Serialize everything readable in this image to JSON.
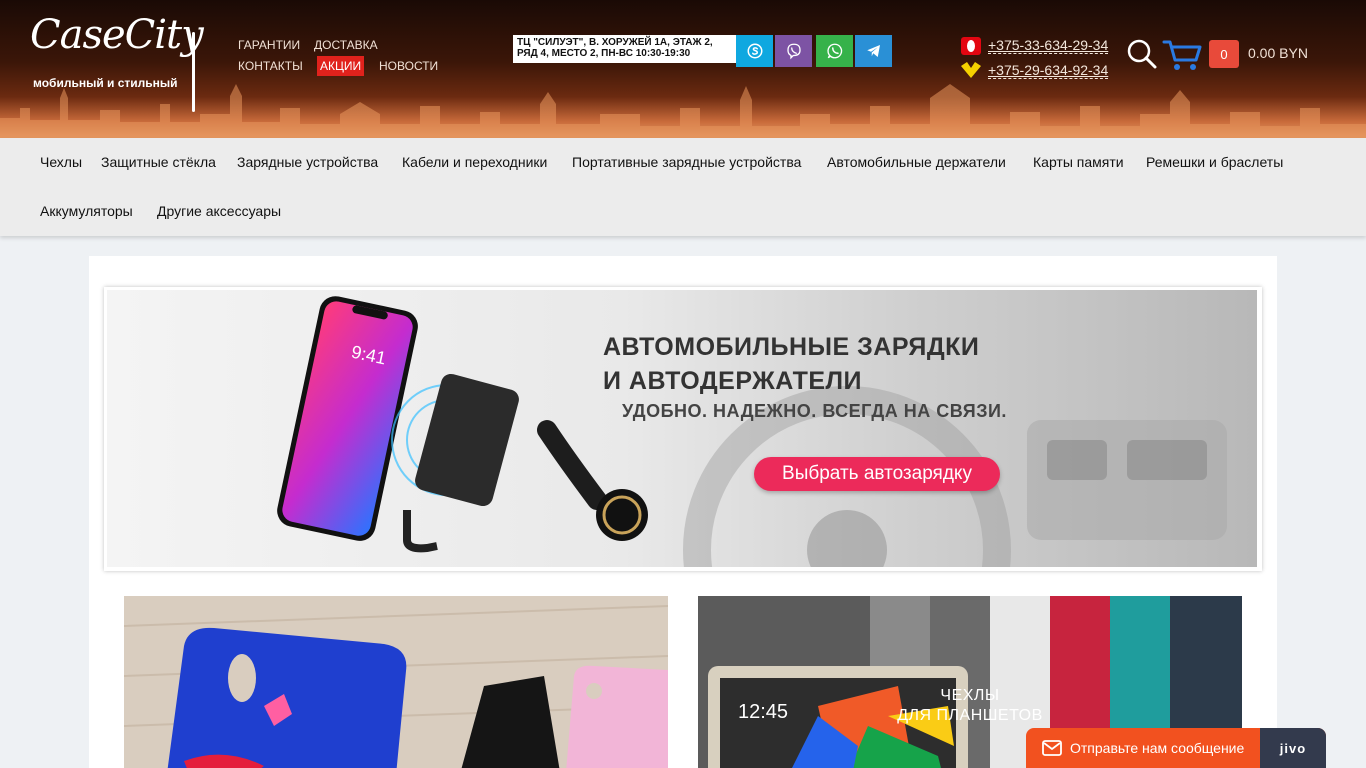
{
  "header": {
    "logo_text": "CaseCity",
    "logo_tagline": "мобильный и стильный",
    "top_links": [
      "ГАРАНТИИ",
      "ДОСТАВКА",
      "КОНТАКТЫ",
      "АКЦИИ",
      "НОВОСТИ"
    ],
    "address": "ТЦ \"СИЛУЭТ\", В. ХОРУЖЕЙ 1А, ЭТАЖ 2, РЯД 4, МЕСТО 2, ПН-ВС 10:30-19:30",
    "socials": [
      {
        "name": "skype-icon",
        "color": "#0fa8e0"
      },
      {
        "name": "viber-icon",
        "color": "#7d53a4"
      },
      {
        "name": "whatsapp-icon",
        "color": "#36b24a"
      },
      {
        "name": "telegram-icon",
        "color": "#2a90d6"
      }
    ],
    "phones": [
      "+375-33-634-29-34",
      "+375-29-634-92-34"
    ],
    "cart_count": "0",
    "cart_total": "0.00 BYN"
  },
  "categories": [
    "Чехлы",
    "Защитные стёкла",
    "Зарядные устройства",
    "Кабели и переходники",
    "Портативные зарядные устройства",
    "Автомобильные держатели",
    "Карты памяти",
    "Ремешки и браслеты",
    "Аккумуляторы",
    "Другие аксессуары"
  ],
  "hero": {
    "title_line1": "АВТОМОБИЛЬНЫЕ ЗАРЯДКИ",
    "title_line2": "И АВТОДЕРЖАТЕЛИ",
    "subtitle": "УДОБНО. НАДЕЖНО. ВСЕГДА НА СВЯЗИ.",
    "cta": "Выбрать автозарядку",
    "phone_time": "9:41"
  },
  "tiles": {
    "tablet_line1": "ЧЕХЛЫ",
    "tablet_line2": "ДЛЯ ПЛАНШЕТОВ",
    "tablet_time": "12:45"
  },
  "chat": {
    "label": "Отправьте нам сообщение",
    "brand": "jivo"
  },
  "colors": {
    "promo_bg": "#e0221c",
    "cta_bg": "#ec2a5a",
    "chat_bg": "#f2511f",
    "cart_accent": "#2a7ae2"
  }
}
